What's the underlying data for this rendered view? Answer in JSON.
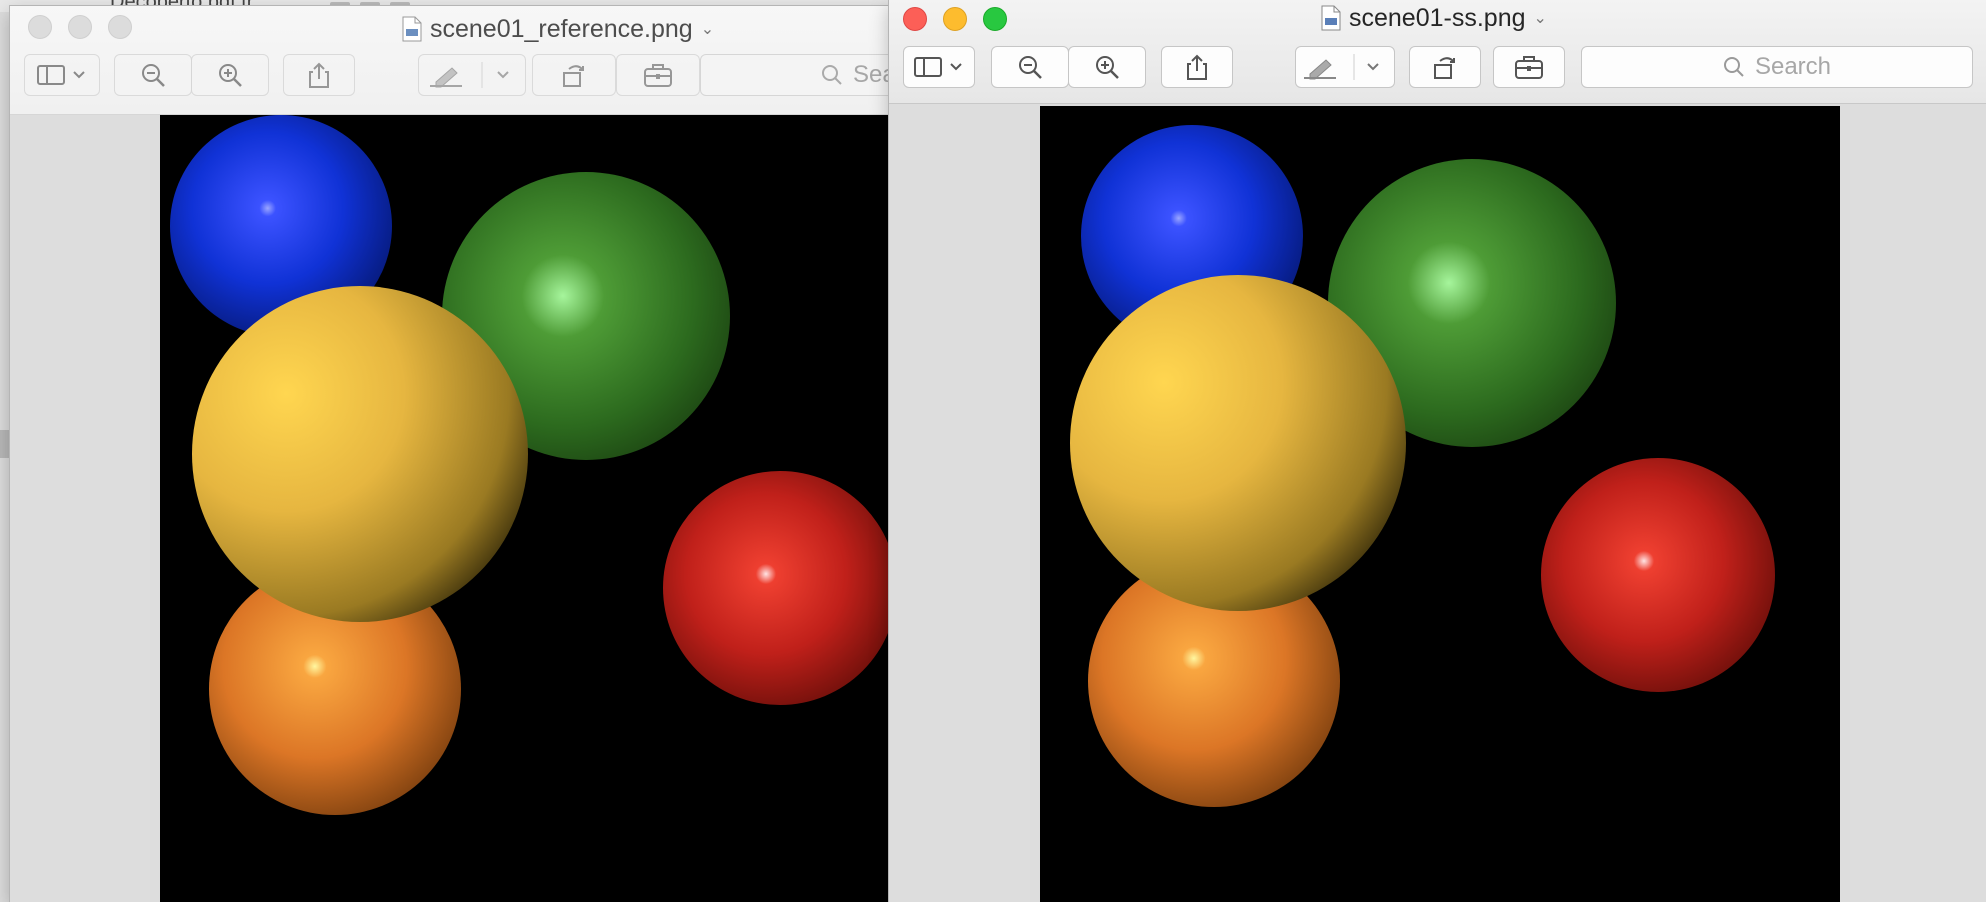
{
  "background_window": {
    "title_fragment": "Decoberto.bdf.tr"
  },
  "windows": [
    {
      "id": "left",
      "state": "inactive",
      "title": "scene01_reference.png",
      "title_chevron": "⌄",
      "search_placeholder": "Sea",
      "toolbar_icons": [
        "sidebar-icon",
        "zoom-out-icon",
        "zoom-in-icon",
        "share-icon",
        "markup-pen-icon",
        "rotate-icon",
        "toolbox-icon"
      ],
      "image": {
        "description_only_visual": true,
        "spheres": [
          {
            "color": "blue",
            "base": "#1030c8"
          },
          {
            "color": "green",
            "base": "#2f7a1e"
          },
          {
            "color": "yellow",
            "base": "#e8b838"
          },
          {
            "color": "red",
            "base": "#c8201a"
          },
          {
            "color": "orange",
            "base": "#e27a24"
          }
        ]
      }
    },
    {
      "id": "right",
      "state": "active",
      "title": "scene01-ss.png",
      "title_chevron": "⌄",
      "search_placeholder": "Search",
      "toolbar_icons": [
        "sidebar-icon",
        "zoom-out-icon",
        "zoom-in-icon",
        "share-icon",
        "markup-pen-icon",
        "rotate-icon",
        "toolbox-icon"
      ],
      "image": {
        "spheres": [
          {
            "color": "blue",
            "base": "#1030c8"
          },
          {
            "color": "green",
            "base": "#2f7a1e"
          },
          {
            "color": "yellow",
            "base": "#e8b838"
          },
          {
            "color": "red",
            "base": "#c8201a"
          },
          {
            "color": "orange",
            "base": "#e27a24"
          }
        ]
      }
    }
  ],
  "colors": {
    "close": "#fc5f57",
    "minimize": "#fdbc2e",
    "maximize": "#28c840",
    "content_bg": "#dddddd",
    "render_bg": "#000000"
  }
}
